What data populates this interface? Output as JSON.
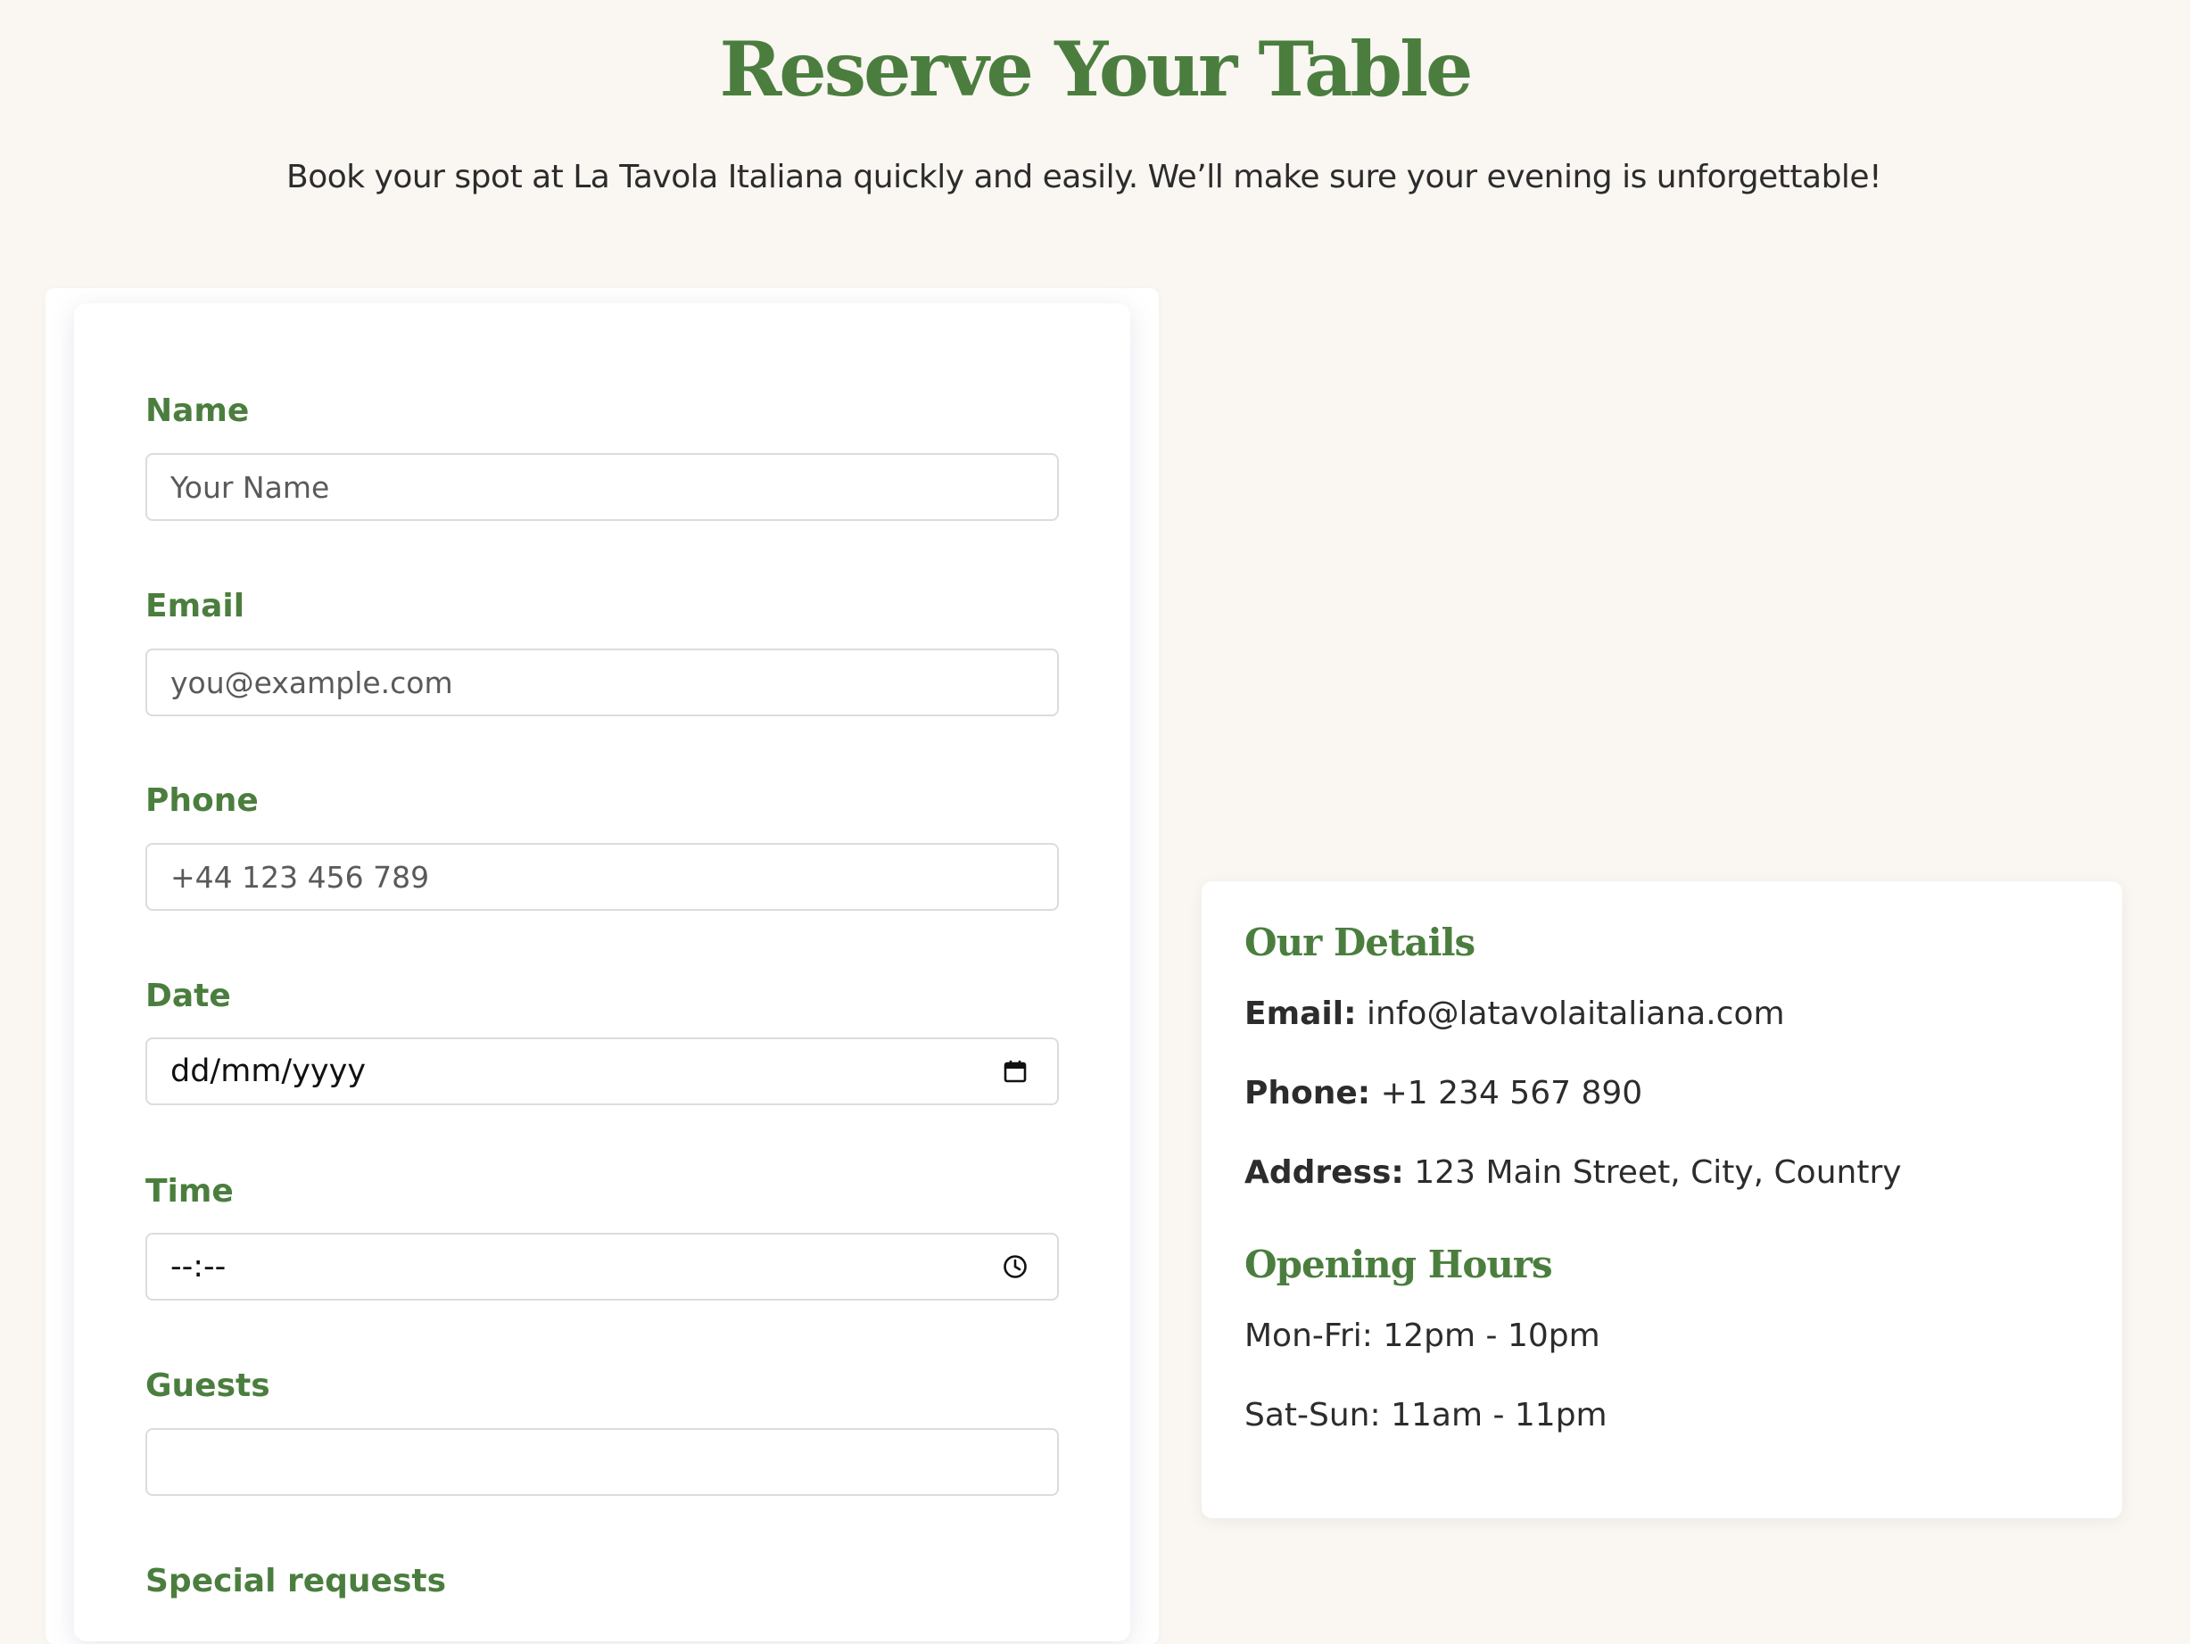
{
  "header": {
    "title": "Reserve Your Table",
    "intro": "Book your spot at La Tavola Italiana quickly and easily. We’ll make sure your evening is unforgettable!"
  },
  "form": {
    "name": {
      "label": "Name",
      "placeholder": "Your Name"
    },
    "email": {
      "label": "Email",
      "placeholder": "you@example.com"
    },
    "phone": {
      "label": "Phone",
      "placeholder": "+44 123 456 789"
    },
    "date": {
      "label": "Date",
      "placeholder": "dd/mm/yyyy",
      "icon": "calendar-icon"
    },
    "time": {
      "label": "Time",
      "placeholder": "--:--",
      "icon": "clock-icon"
    },
    "guests": {
      "label": "Guests",
      "value": ""
    },
    "special": {
      "label": "Special requests"
    }
  },
  "details": {
    "heading": "Our Details",
    "email_label": "Email:",
    "email_value": "info@latavolaitaliana.com",
    "phone_label": "Phone:",
    "phone_value": "+1 234 567 890",
    "address_label": "Address:",
    "address_value": "123 Main Street, City, Country"
  },
  "hours": {
    "heading": "Opening Hours",
    "weekdays": "Mon-Fri: 12pm - 10pm",
    "weekend": "Sat-Sun: 11am - 11pm"
  },
  "colors": {
    "accent": "#4b7e3e",
    "background": "#faf6f2",
    "text": "#2c2c2c"
  }
}
